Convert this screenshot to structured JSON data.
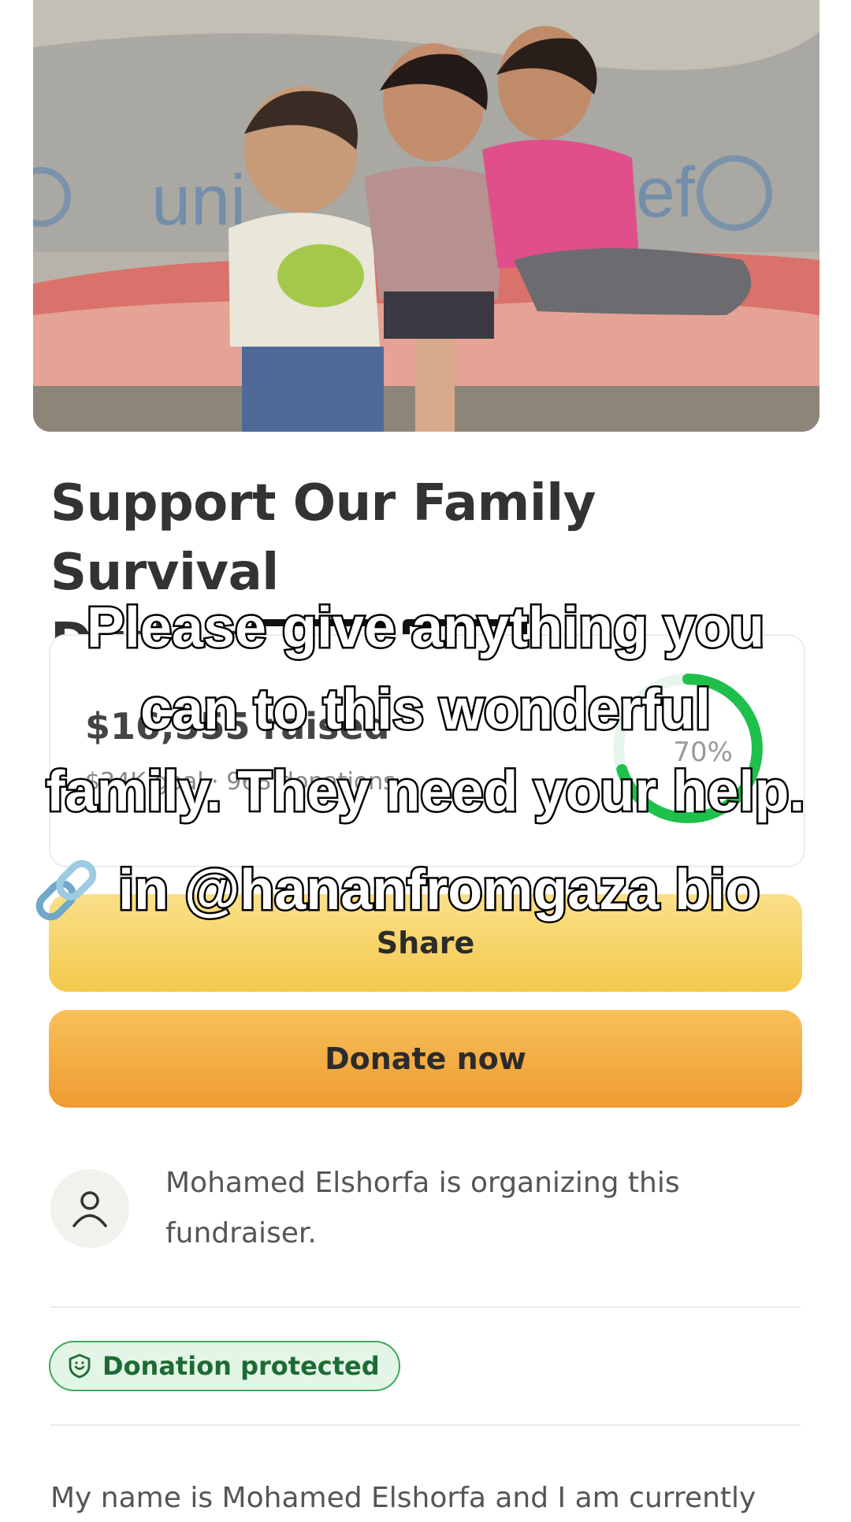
{
  "campaign": {
    "title_line1": "Support Our Family Survival",
    "title_line2_visible": "During",
    "raised_text": "$16,555 raised",
    "goal_text": "$24K goal · 968 donations",
    "progress_percent_label": "70%",
    "progress_fraction": 0.7
  },
  "buttons": {
    "share_label": "Share",
    "donate_label": "Donate now"
  },
  "organizer": {
    "text": "Mohamed Elshorfa is organizing this fundraiser."
  },
  "badge": {
    "label": "Donation protected"
  },
  "story": {
    "first_line": "My name is Mohamed Elshorfa and I am currently"
  },
  "overlay_caption": {
    "lines": [
      "Please give anything you",
      "can to this wonderful",
      "family. They need your help."
    ],
    "link_line": "in @hananfromgaza bio"
  },
  "hero_image": {
    "watermark_left": "uni",
    "watermark_right": "icef"
  },
  "colors": {
    "share_button": "#f3c94c",
    "donate_button": "#ef9a31",
    "progress_ring": "#1fbf4c",
    "badge_border": "#3ea85a"
  },
  "icons": {
    "organizer": "person-icon",
    "badge": "shield-icon",
    "caption": "link-icon"
  }
}
